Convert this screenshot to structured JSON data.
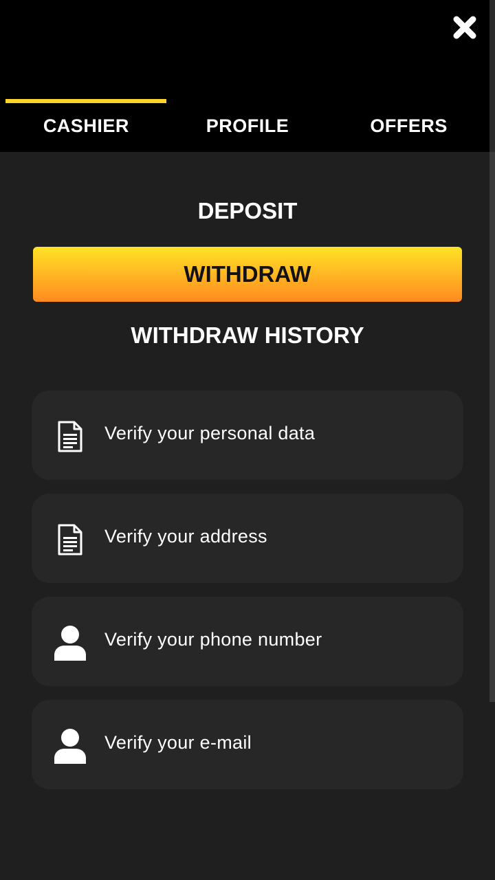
{
  "header": {
    "close_icon": "close-icon",
    "tabs": [
      {
        "label": "CASHIER",
        "active": true
      },
      {
        "label": "PROFILE",
        "active": false
      },
      {
        "label": "OFFERS",
        "active": false
      }
    ]
  },
  "cashier": {
    "deposit_label": "DEPOSIT",
    "withdraw_label": "WITHDRAW",
    "withdraw_history_label": "WITHDRAW HISTORY"
  },
  "verification": {
    "items": [
      {
        "label": "Verify your personal data",
        "icon": "document-icon"
      },
      {
        "label": "Verify your address",
        "icon": "document-icon"
      },
      {
        "label": "Verify your phone number",
        "icon": "user-icon"
      },
      {
        "label": "Verify your e-mail",
        "icon": "user-icon"
      }
    ]
  },
  "colors": {
    "background": "#1f1f20",
    "header": "#000000",
    "accent": "#ffd42a",
    "button_top": "#ffe326",
    "button_bottom": "#ff8a20",
    "card": "#272727"
  }
}
